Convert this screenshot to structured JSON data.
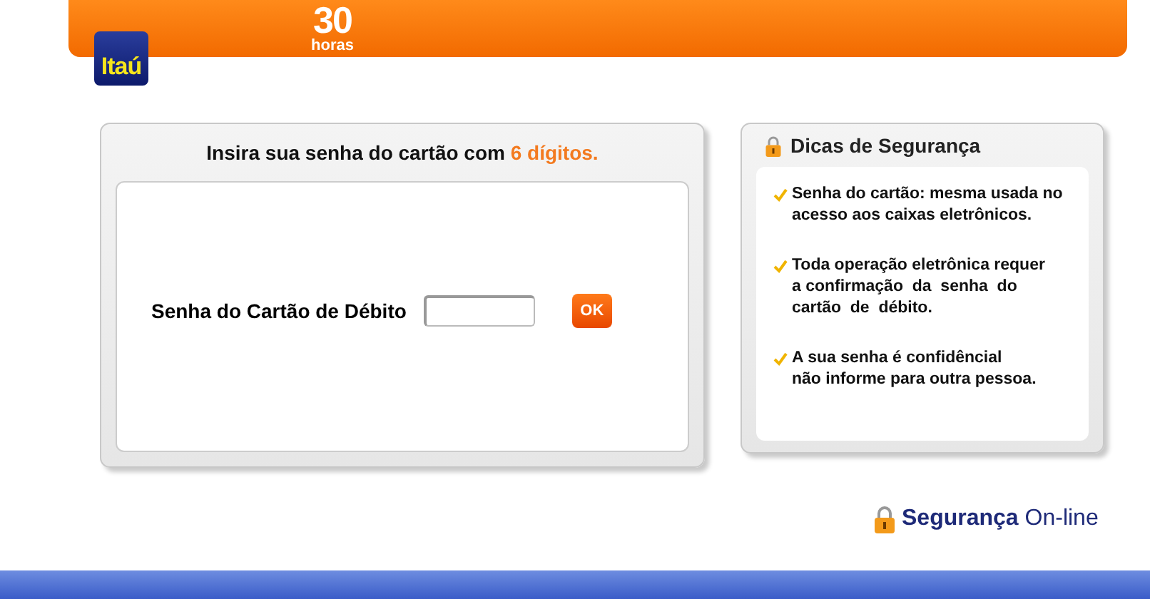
{
  "header": {
    "logo": "Itaú",
    "badge_number": "30",
    "badge_unit": "horas"
  },
  "password_panel": {
    "title": "Insira sua senha do cartão com ",
    "title_highlight": "6 dígitos.",
    "field_label": "Senha do Cartão de Débito",
    "button": "OK"
  },
  "tips_panel": {
    "title": "Dicas de Segurança",
    "tips": [
      {
        "lines": [
          "Senha do cartão: mesma usada no",
          "acesso aos caixas eletrônicos."
        ]
      },
      {
        "lines": [
          "Toda operação eletrônica requer",
          "a confirmação  da  senha  do",
          "cartão  de  débito."
        ]
      },
      {
        "lines": [
          "A sua senha é confidêncial",
          "não informe para outra pessoa."
        ]
      }
    ]
  },
  "footer": {
    "brand_bold": "Segurança",
    "brand_rest": "On-line"
  }
}
